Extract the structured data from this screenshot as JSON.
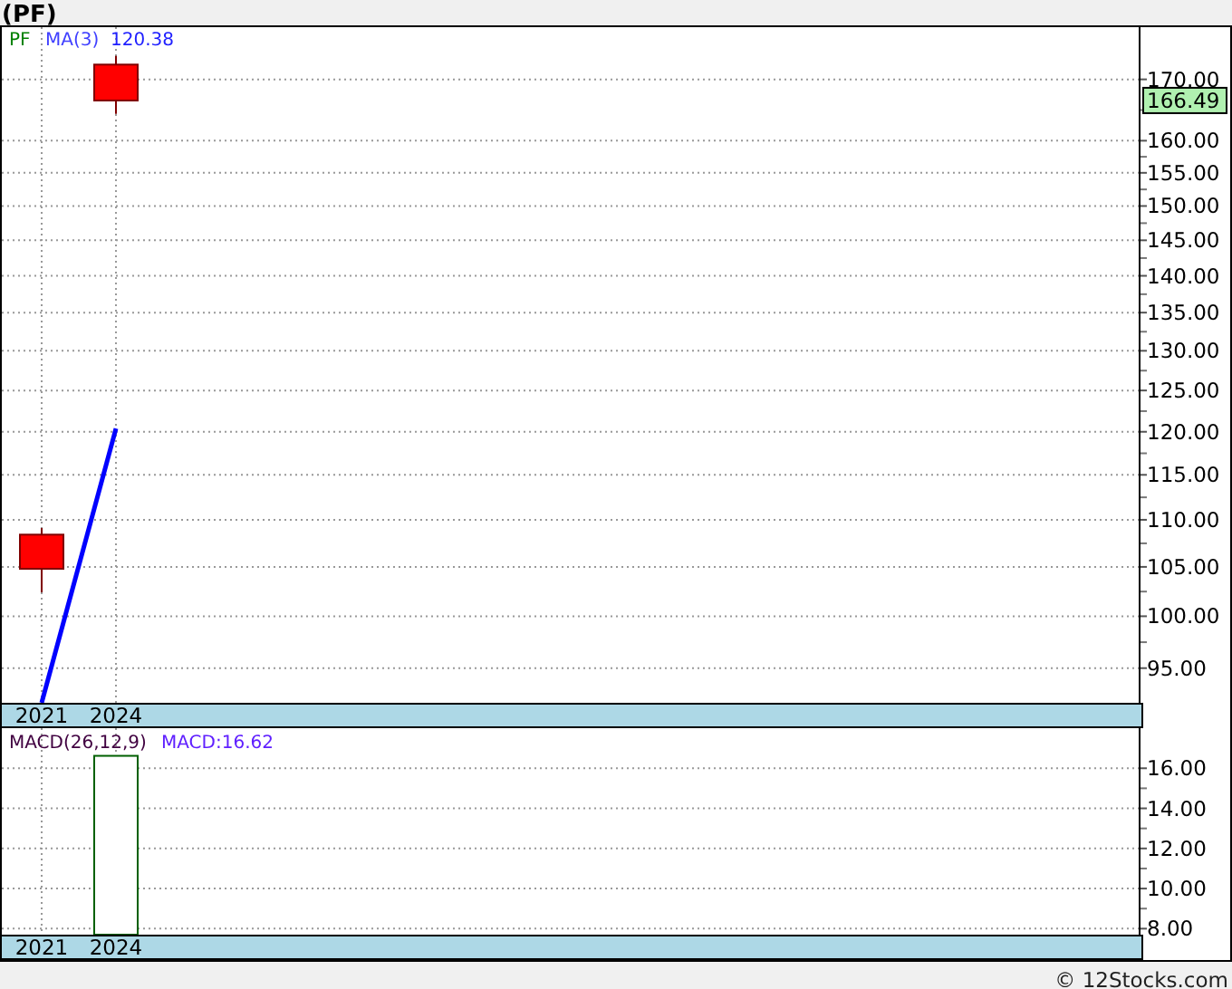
{
  "title": "(PF)",
  "price_chart": {
    "legend": {
      "symbol": "PF",
      "indicator": "MA(3)",
      "indicator_value": "120.38"
    },
    "last_price": "166.49",
    "axis_labels": [
      "170.00",
      "160.00",
      "155.00",
      "150.00",
      "145.00",
      "140.00",
      "135.00",
      "130.00",
      "125.00",
      "120.00",
      "115.00",
      "110.00",
      "105.00",
      "100.00",
      "95.00"
    ],
    "x_labels": [
      "2021",
      "2024"
    ]
  },
  "macd_chart": {
    "legend": "MACD(26,12,9)",
    "value_label": "MACD:16.62",
    "axis_labels": [
      "16.00",
      "14.00",
      "12.00",
      "10.00",
      "8.00"
    ],
    "x_labels": [
      "2021",
      "2024"
    ]
  },
  "footer": "© 12Stocks.com"
}
